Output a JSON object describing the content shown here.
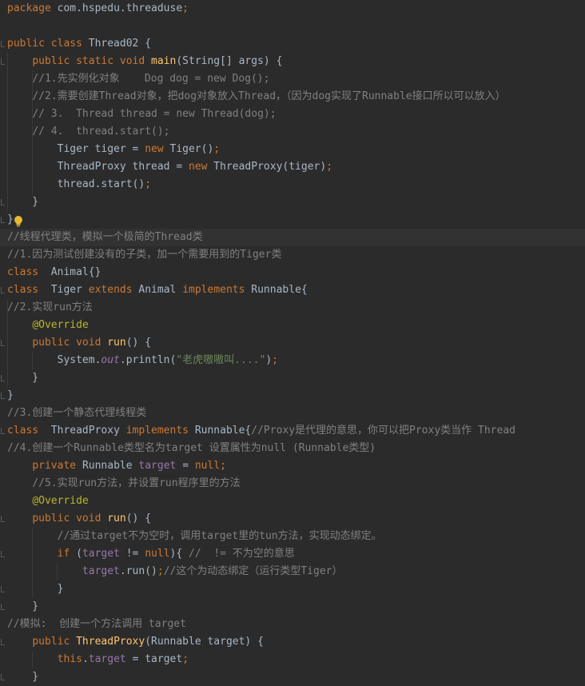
{
  "editor": {
    "language": "Java",
    "highlighted_line": 13,
    "colors": {
      "background": "#2b2b2b",
      "keyword": "#cc7832",
      "method": "#ffc66d",
      "comment": "#808080",
      "string": "#6a8759",
      "field": "#9876aa",
      "annotation": "#bbb529",
      "text": "#a9b7c6"
    },
    "intention_icon": "lightbulb-icon"
  },
  "lines": [
    [
      [
        "kw",
        "package "
      ],
      [
        "tx",
        "com.hspedu.threaduse"
      ],
      [
        "kw",
        ";"
      ]
    ],
    [],
    [
      [
        "kw",
        "public class "
      ],
      [
        "tx",
        "Thread02 {"
      ]
    ],
    [
      [
        "tx",
        "    "
      ],
      [
        "kw",
        "public static void "
      ],
      [
        "fn",
        "main"
      ],
      [
        "tx",
        "(String[] args) {"
      ]
    ],
    [
      [
        "tx",
        "    "
      ],
      [
        "cm",
        "//1.先实例化对象    Dog dog = new Dog();"
      ]
    ],
    [
      [
        "tx",
        "    "
      ],
      [
        "cm",
        "//2.需要创建Thread对象，把dog对象放入Thread，（因为dog实现了Runnable接口所以可以放入）"
      ]
    ],
    [
      [
        "tx",
        "    "
      ],
      [
        "cm",
        "// 3.  Thread thread = new Thread(dog);"
      ]
    ],
    [
      [
        "tx",
        "    "
      ],
      [
        "cm",
        "// 4.  thread.start();"
      ]
    ],
    [
      [
        "tx",
        "        Tiger tiger = "
      ],
      [
        "kw",
        "new "
      ],
      [
        "tx",
        "Tiger()"
      ],
      [
        "kw",
        ";"
      ]
    ],
    [
      [
        "tx",
        "        ThreadProxy thread = "
      ],
      [
        "kw",
        "new "
      ],
      [
        "tx",
        "ThreadProxy(tiger)"
      ],
      [
        "kw",
        ";"
      ]
    ],
    [
      [
        "tx",
        "        thread.start()"
      ],
      [
        "kw",
        ";"
      ]
    ],
    [
      [
        "tx",
        "    }"
      ]
    ],
    [
      [
        "tx",
        "}"
      ]
    ],
    [
      [
        "cm",
        "//线程代理类，模拟一个极简的Thread类"
      ]
    ],
    [
      [
        "cm",
        "//1.因为测试创建没有的子类，加一个需要用到的Tiger类"
      ]
    ],
    [
      [
        "kw",
        "class  "
      ],
      [
        "tx",
        "Animal{}"
      ]
    ],
    [
      [
        "kw",
        "class  "
      ],
      [
        "tx",
        "Tiger "
      ],
      [
        "kw",
        "extends "
      ],
      [
        "tx",
        "Animal "
      ],
      [
        "kw",
        "implements "
      ],
      [
        "tx",
        "Runnable{"
      ]
    ],
    [
      [
        "cm",
        "//2.实现run方法"
      ]
    ],
    [
      [
        "tx",
        "    "
      ],
      [
        "an",
        "@Override"
      ]
    ],
    [
      [
        "tx",
        "    "
      ],
      [
        "kw",
        "public void "
      ],
      [
        "fn",
        "run"
      ],
      [
        "tx",
        "() {"
      ]
    ],
    [
      [
        "tx",
        "        System."
      ],
      [
        "it",
        "out"
      ],
      [
        "tx",
        ".println("
      ],
      [
        "st",
        "\"老虎嗷嗷叫....\""
      ],
      [
        "tx",
        ")"
      ],
      [
        "kw",
        ";"
      ]
    ],
    [
      [
        "tx",
        "    }"
      ]
    ],
    [
      [
        "tx",
        "}"
      ]
    ],
    [
      [
        "cm",
        "//3.创建一个静态代理线程类"
      ]
    ],
    [
      [
        "kw",
        "class  "
      ],
      [
        "tx",
        "ThreadProxy "
      ],
      [
        "kw",
        "implements "
      ],
      [
        "tx",
        "Runnable{"
      ],
      [
        "cm",
        "//Proxy是代理的意思，你可以把Proxy类当作 Thread"
      ]
    ],
    [
      [
        "cm",
        "//4.创建一个Runnable类型名为target 设置属性为null (Runnable类型)"
      ]
    ],
    [
      [
        "tx",
        "    "
      ],
      [
        "kw",
        "private "
      ],
      [
        "tx",
        "Runnable "
      ],
      [
        "fd",
        "target "
      ],
      [
        "tx",
        "= "
      ],
      [
        "kw",
        "null;"
      ]
    ],
    [
      [
        "tx",
        "    "
      ],
      [
        "cm",
        "//5.实现run方法，并设置run程序里的方法"
      ]
    ],
    [
      [
        "tx",
        "    "
      ],
      [
        "an",
        "@Override"
      ]
    ],
    [
      [
        "tx",
        "    "
      ],
      [
        "kw",
        "public void "
      ],
      [
        "fn",
        "run"
      ],
      [
        "tx",
        "() {"
      ]
    ],
    [
      [
        "tx",
        "        "
      ],
      [
        "cm",
        "//通过target不为空时，调用target里的tun方法，实现动态绑定。"
      ]
    ],
    [
      [
        "tx",
        "        "
      ],
      [
        "kw",
        "if "
      ],
      [
        "tx",
        "("
      ],
      [
        "fd",
        "target "
      ],
      [
        "tx",
        "!= "
      ],
      [
        "kw",
        "null"
      ],
      [
        "tx",
        "){ "
      ],
      [
        "cm",
        "//  != 不为空的意思"
      ]
    ],
    [
      [
        "tx",
        "            "
      ],
      [
        "fd",
        "target"
      ],
      [
        "tx",
        ".run()"
      ],
      [
        "kw",
        ";"
      ],
      [
        "cm",
        "//这个为动态绑定（运行类型Tiger）"
      ]
    ],
    [
      [
        "tx",
        "        }"
      ]
    ],
    [
      [
        "tx",
        "    }"
      ]
    ],
    [
      [
        "cm",
        "//模拟:  创建一个方法调用 target"
      ]
    ],
    [
      [
        "tx",
        "    "
      ],
      [
        "kw",
        "public "
      ],
      [
        "fn",
        "ThreadProxy"
      ],
      [
        "tx",
        "(Runnable target) {"
      ]
    ],
    [
      [
        "tx",
        "        "
      ],
      [
        "kw",
        "this"
      ],
      [
        "tx",
        "."
      ],
      [
        "fd",
        "target "
      ],
      [
        "tx",
        "= target"
      ],
      [
        "kw",
        ";"
      ]
    ],
    [
      [
        "tx",
        "    }"
      ]
    ]
  ]
}
